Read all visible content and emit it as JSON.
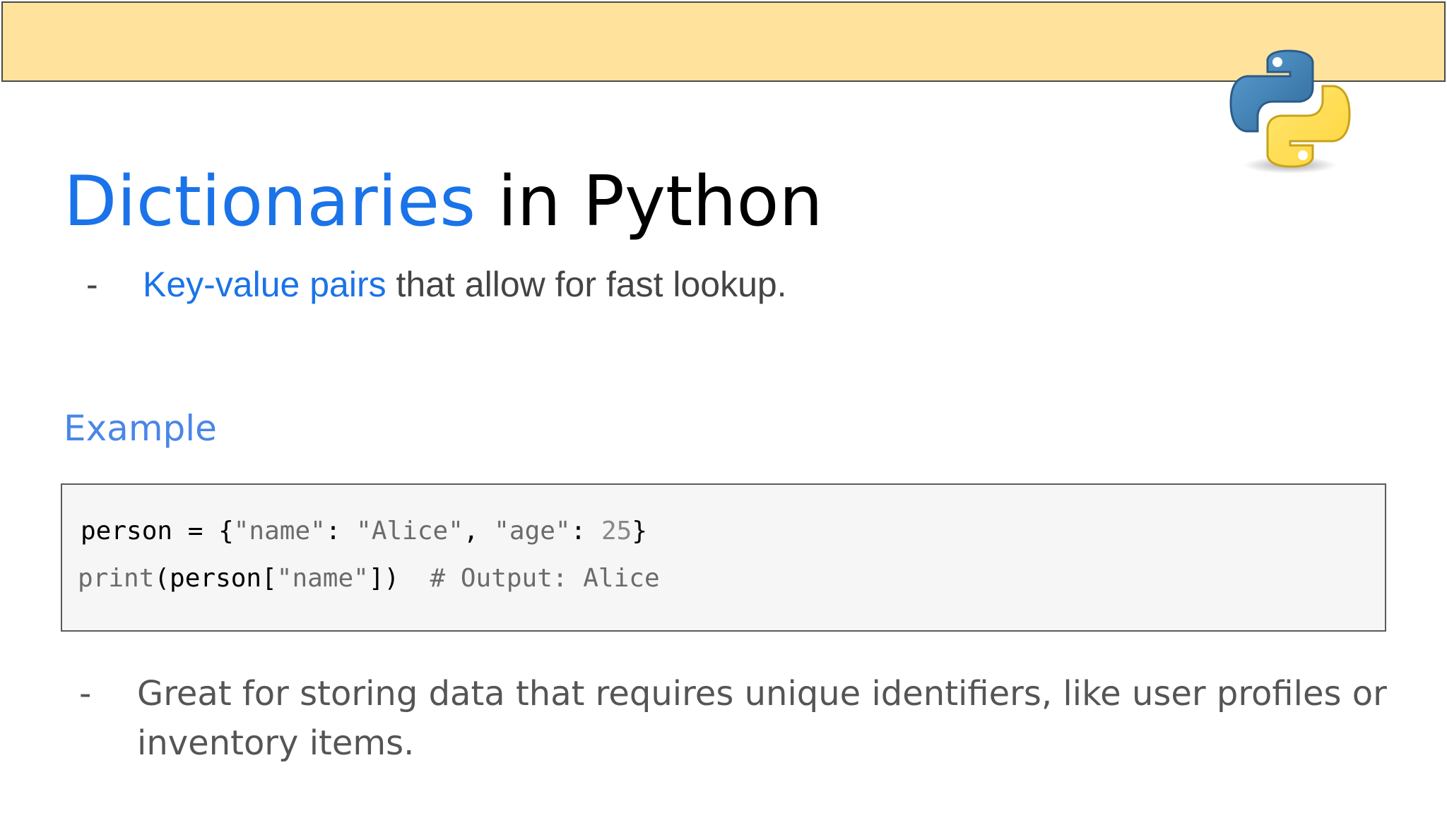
{
  "slide": {
    "title_accent": "Dictionaries",
    "title_rest": " in Python",
    "bullet1": {
      "dash": "-",
      "accent": "Key-value pairs",
      "rest": " that allow for fast lookup."
    },
    "section_heading": "Example",
    "code": {
      "line1": [
        {
          "t": "person = {",
          "k": "plain"
        },
        {
          "t": "\"name\"",
          "k": "str"
        },
        {
          "t": ": ",
          "k": "plain"
        },
        {
          "t": "\"Alice\"",
          "k": "str"
        },
        {
          "t": ", ",
          "k": "plain"
        },
        {
          "t": "\"age\"",
          "k": "str"
        },
        {
          "t": ": ",
          "k": "plain"
        },
        {
          "t": "25",
          "k": "num"
        },
        {
          "t": "}",
          "k": "plain"
        }
      ],
      "line2": [
        {
          "t": "print",
          "k": "fn"
        },
        {
          "t": "(person[",
          "k": "plain"
        },
        {
          "t": "\"name\"",
          "k": "str"
        },
        {
          "t": "])  ",
          "k": "plain"
        },
        {
          "t": "# Output: Alice",
          "k": "cmt"
        }
      ]
    },
    "bullet2": {
      "dash": "-",
      "text": "Great for storing data that requires unique identifiers, like user profiles or inventory items."
    }
  },
  "logo": {
    "icon": "python-logo-icon",
    "colors": {
      "blue": "#3c74a8",
      "blue_dark": "#2c5b8a",
      "yellow": "#ffd43b",
      "yellow_dark": "#d9a920"
    }
  },
  "colors": {
    "header_bar": "#ffe39c",
    "accent_blue": "#1a73e8",
    "heading_blue": "#4a86e8",
    "code_bg": "#f6f6f6"
  }
}
